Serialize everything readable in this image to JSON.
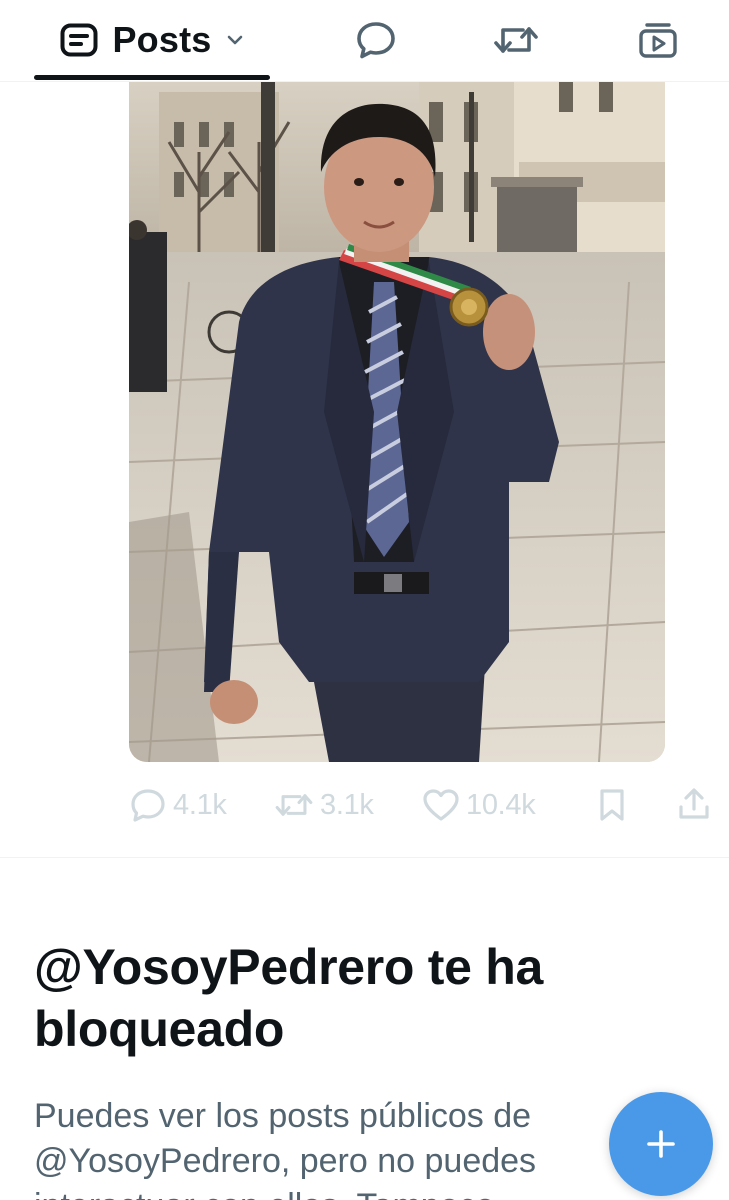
{
  "tabs": {
    "posts_label": "Posts"
  },
  "post": {
    "stats": {
      "replies": "4.1k",
      "reposts": "3.1k",
      "likes": "10.4k"
    }
  },
  "blocked_notice": {
    "title": "@YosoyPedrero te ha bloqueado",
    "body": "Puedes ver los posts públicos de @YosoyPedrero, pero no puedes interactuar con ellos. Tampoco"
  },
  "colors": {
    "accent": "#4a99e9",
    "text_primary": "#0f1419",
    "text_secondary": "#536471",
    "action_disabled": "#cfd9de"
  },
  "icons": {
    "posts_tab": "posts-list-icon",
    "dropdown": "chevron-down-icon",
    "replies_tab": "speech-bubble-icon",
    "reposts_tab": "repost-icon",
    "media_tab": "media-play-icon",
    "reply": "reply-icon",
    "repost": "repost-icon",
    "like": "heart-icon",
    "bookmark": "bookmark-icon",
    "share": "share-icon",
    "compose": "plus-icon"
  }
}
